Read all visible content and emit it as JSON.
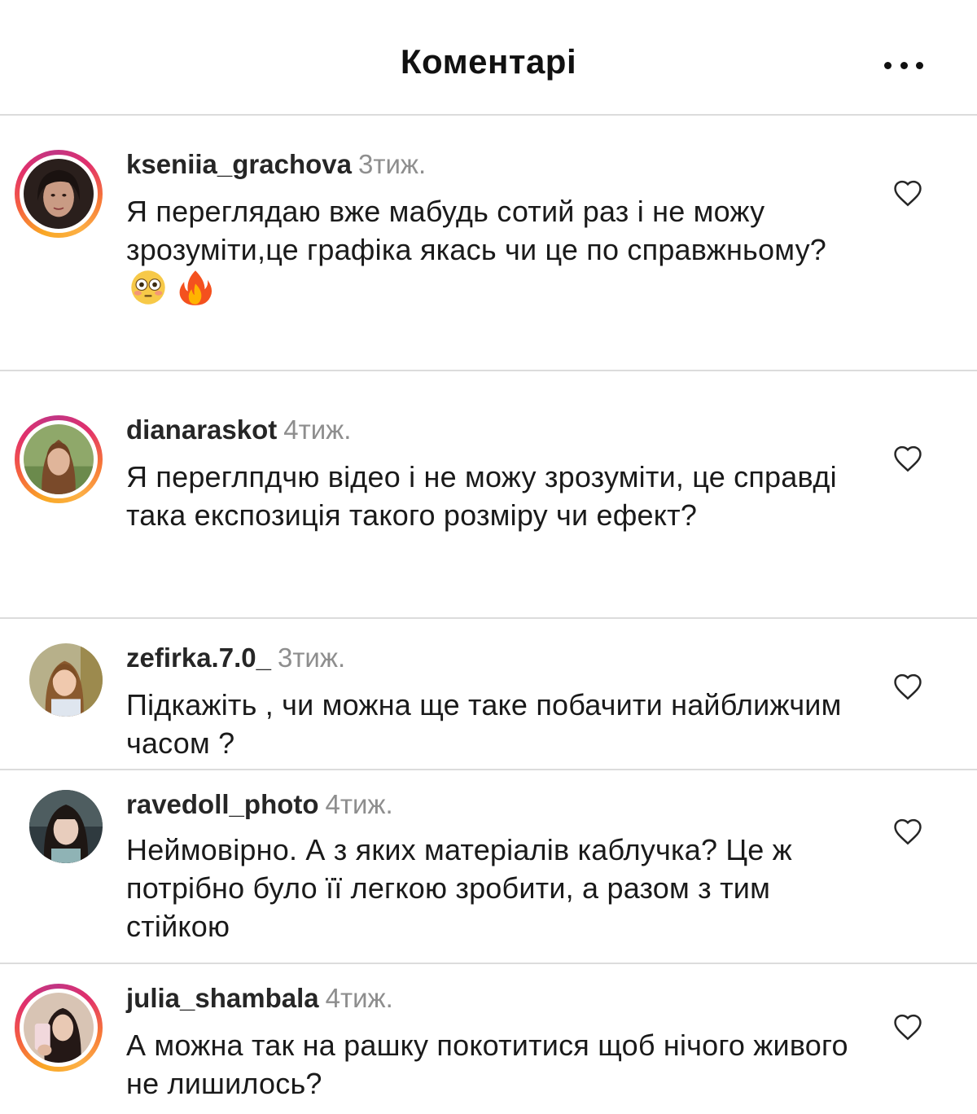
{
  "header": {
    "title": "Коментарі",
    "more_icon": "more-horizontal-icon"
  },
  "colors": {
    "time": "#8e8e8e",
    "divider": "#dcdcdc",
    "text": "#1a1a1a"
  },
  "comments": [
    {
      "username": "kseniia_grachova",
      "time": "3тиж.",
      "text": "Я переглядаю вже мабудь сотий раз і не можу зрозуміти,це графіка якась чи це по справжньому?",
      "emojis": [
        "flushed-face-emoji",
        "fire-emoji"
      ],
      "story_ring": true
    },
    {
      "username": "dianaraskot",
      "time": "4тиж.",
      "text": "Я переглпдчю відео і не можу зрозуміти, це справді така експозиція такого розміру чи ефект?",
      "story_ring": true
    },
    {
      "username": "zefirka.7.0_",
      "time": "3тиж.",
      "text": "Підкажіть , чи можна ще таке побачити найближчим часом ?",
      "story_ring": false
    },
    {
      "username": "ravedoll_photo",
      "time": "4тиж.",
      "text": "Неймовірно. А з яких матеріалів каблучка? Це ж потрібно було її легкою зробити, а разом з тим стійкою",
      "story_ring": false
    },
    {
      "username": "julia_shambala",
      "time": "4тиж.",
      "text": "А можна так на рашку покотитися щоб нічого живого не лишилось?",
      "story_ring": true
    }
  ]
}
